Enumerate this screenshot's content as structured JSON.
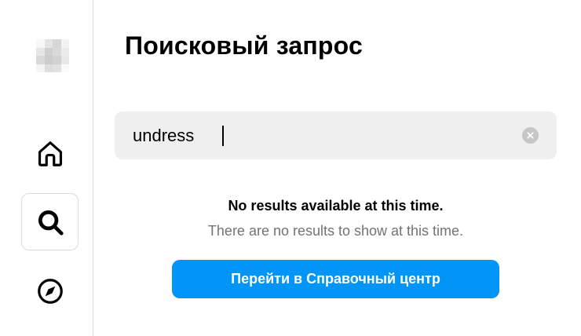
{
  "sidebar": {
    "logo": {
      "label": "blurred-profile-image"
    },
    "items": [
      {
        "icon": "home-icon",
        "active": false
      },
      {
        "icon": "search-icon",
        "active": true
      },
      {
        "icon": "explore-compass-icon",
        "active": false
      }
    ]
  },
  "main": {
    "title": "Поисковый запрос",
    "search": {
      "value": "undress",
      "clear_icon": "clear-circle-x-icon"
    },
    "empty_state": {
      "title": "No results available at this time.",
      "subtitle": "There are no results to show at this time."
    },
    "help_button": {
      "label": "Перейти в Справочный центр"
    }
  },
  "colors": {
    "accent": "#0095f6",
    "search_bg": "#efefef",
    "muted_text": "#737373",
    "border": "#dbdbdb"
  }
}
